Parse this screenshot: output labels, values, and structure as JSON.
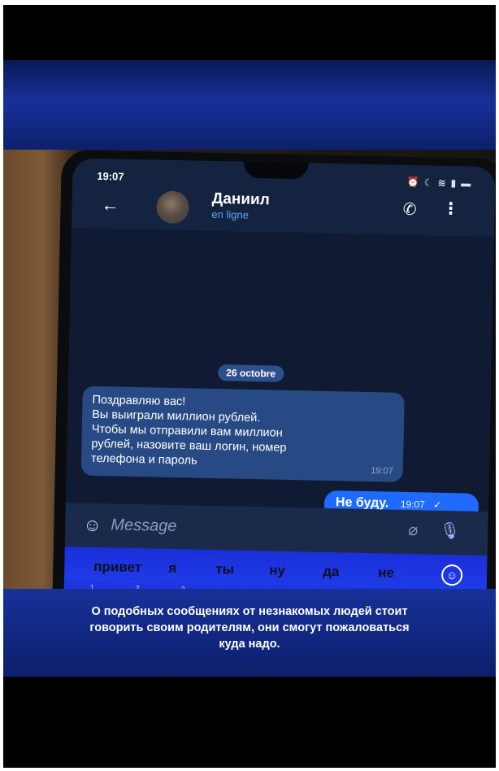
{
  "status_bar": {
    "time": "19:07",
    "icons": [
      "alarm-icon",
      "moon-icon",
      "wifi-icon",
      "signal-icon",
      "battery-icon"
    ]
  },
  "chat_header": {
    "contact_name": "Даниил",
    "contact_status": "en ligne"
  },
  "chat": {
    "date_separator": "26 octobre",
    "messages": [
      {
        "direction": "incoming",
        "lines": [
          "Поздравляю вас!",
          "Вы выиграли миллион рублей.",
          "Чтобы мы отправили вам миллион",
          "рублей, назовите ваш логин, номер",
          "телефона и пароль"
        ],
        "time": "19:07"
      },
      {
        "direction": "outgoing",
        "text": "Не буду.",
        "time": "19:07",
        "status_icon": "check-icon"
      }
    ]
  },
  "composer": {
    "placeholder": "Message"
  },
  "keyboard": {
    "suggestions": [
      "привет",
      "я",
      "ты",
      "ну",
      "да",
      "не"
    ],
    "digit_hints": [
      "1",
      "2",
      "3"
    ]
  },
  "caption": {
    "lines": [
      "О подобных сообщениях от незнакомых людей стоит",
      "говорить своим родителям, они смогут пожаловаться",
      "куда надо."
    ]
  },
  "colors": {
    "band_blue": "#16319a",
    "outgoing_bubble": "#1f6bff",
    "incoming_bubble": "#284a84",
    "status_text": "#5ea2ff"
  }
}
